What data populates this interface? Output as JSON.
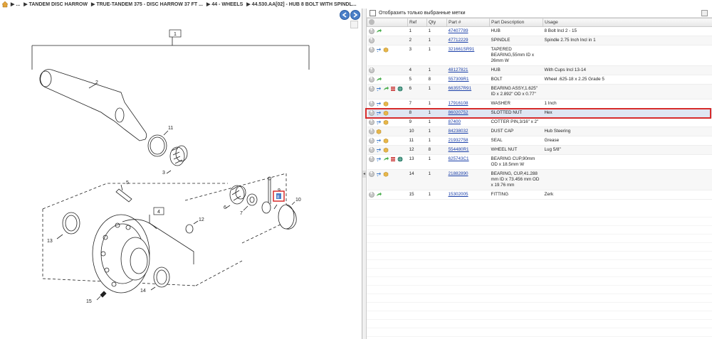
{
  "breadcrumb": {
    "items": [
      "...",
      "TANDEM DISC HARROW",
      "TRUE-TANDEM 375 - DISC HARROW 37 FT ...",
      "44 - WHEELS",
      "44.530.AA[02] - HUB 8 BOLT WITH SPINDL..."
    ]
  },
  "toolbar": {
    "filter_label": "Отобразить только выбранные метки"
  },
  "table": {
    "headers": {
      "ref": "Ref",
      "qty": "Qty",
      "part": "Part #",
      "desc": "Part Description",
      "usage": "Usage"
    },
    "rows": [
      {
        "ref": "1",
        "qty": "1",
        "part": "47407789",
        "desc": "HUB",
        "usage": "8 Bolt Incl 2 - 15",
        "icons": [
          "arrow"
        ]
      },
      {
        "ref": "2",
        "qty": "1",
        "part": "47712229",
        "desc": "SPINDLE",
        "usage": "Spindle 2.75 Inch Incl in 1",
        "icons": []
      },
      {
        "ref": "3",
        "qty": "1",
        "part": "321661SR91",
        "desc": "TAPERED BEARING,55mm ID x 26mm W",
        "usage": "",
        "icons": [
          "swap",
          "box"
        ]
      },
      {
        "ref": "4",
        "qty": "1",
        "part": "48127821",
        "desc": "HUB",
        "usage": "With Cups Incl 13-14",
        "icons": []
      },
      {
        "ref": "5",
        "qty": "8",
        "part": "557309R1",
        "desc": "BOLT",
        "usage": "Wheel .625-18 x 2.25 Grade 5",
        "icons": [
          "arrow"
        ]
      },
      {
        "ref": "6",
        "qty": "1",
        "part": "663557R91",
        "desc": "BEARING ASSY,1.625\" ID x 2.892\" OD x 0.77\"",
        "usage": "",
        "icons": [
          "swap",
          "arrow",
          "list",
          "globe"
        ]
      },
      {
        "ref": "7",
        "qty": "1",
        "part": "17916108",
        "desc": "WASHER",
        "usage": "1 Inch",
        "icons": [
          "swap",
          "box"
        ]
      },
      {
        "ref": "8",
        "qty": "1",
        "part": "86020752",
        "desc": "SLOTTED NUT",
        "usage": "Hex",
        "icons": [
          "swap",
          "box"
        ]
      },
      {
        "ref": "9",
        "qty": "1",
        "part": "87400",
        "desc": "COTTER PIN,3/16\" x 2\"",
        "usage": "",
        "icons": [
          "swap",
          "box"
        ]
      },
      {
        "ref": "10",
        "qty": "1",
        "part": "84238032",
        "desc": "DUST CAP",
        "usage": "Hub Steering",
        "icons": [
          "box"
        ]
      },
      {
        "ref": "11",
        "qty": "1",
        "part": "21932758",
        "desc": "SEAL",
        "usage": "Grease",
        "icons": [
          "swap",
          "box"
        ]
      },
      {
        "ref": "12",
        "qty": "8",
        "part": "554480R1",
        "desc": "WHEEL NUT",
        "usage": "Lug 5/8\"",
        "icons": [
          "swap",
          "box"
        ]
      },
      {
        "ref": "13",
        "qty": "1",
        "part": "625743C1",
        "desc": "BEARING CUP,90mm OD x 18.5mm W",
        "usage": "",
        "icons": [
          "swap",
          "arrow",
          "list",
          "globe"
        ]
      },
      {
        "ref": "14",
        "qty": "1",
        "part": "21882890",
        "desc": "BEARING, CUP,41.288 mm ID x 73.456 mm OD x 19.76 mm",
        "usage": "",
        "icons": [
          "swap",
          "box"
        ]
      },
      {
        "ref": "15",
        "qty": "1",
        "part": "15302005",
        "desc": "FITTING",
        "usage": "Zerk",
        "icons": [
          "arrow"
        ]
      }
    ],
    "selected_ref": "8"
  },
  "diagram": {
    "callouts": [
      "1",
      "2",
      "3",
      "4",
      "5",
      "6",
      "7",
      "8",
      "9",
      "10",
      "11",
      "12",
      "13",
      "14",
      "15"
    ]
  },
  "colors": {
    "accent": "#4a7fc8",
    "selection": "#d62b2b",
    "link": "#1a3fa8"
  }
}
